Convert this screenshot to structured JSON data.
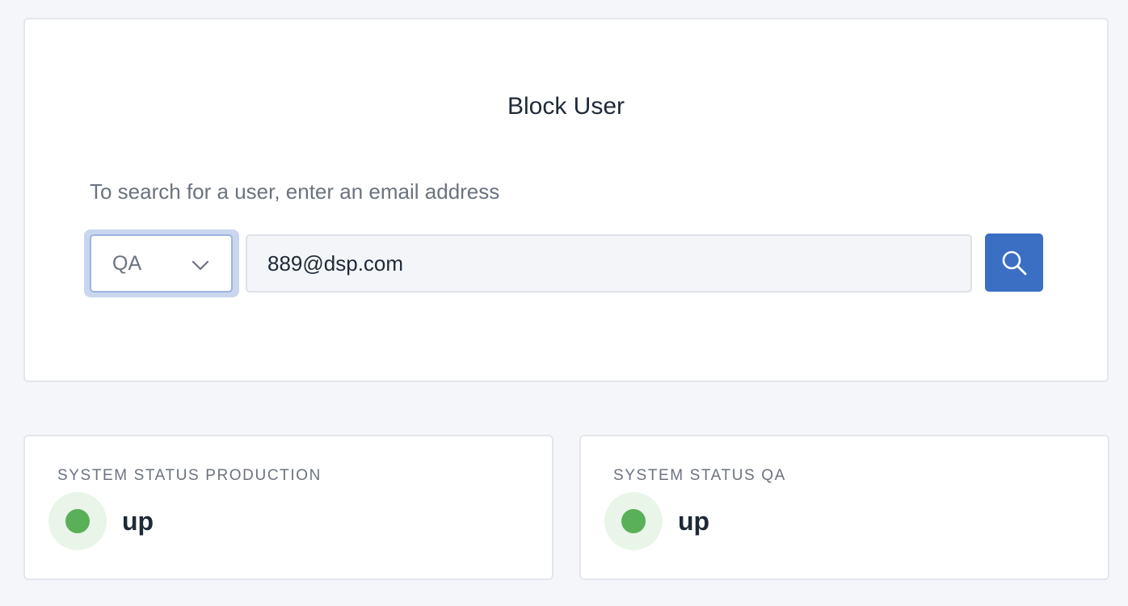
{
  "block_user": {
    "title": "Block User",
    "instruction": "To search for a user, enter an email address",
    "environment_select": {
      "selected": "QA"
    },
    "email_input": {
      "value": "889@dsp.com"
    },
    "search_button": {
      "icon": "search-icon"
    }
  },
  "status": [
    {
      "label": "SYSTEM STATUS PRODUCTION",
      "value": "up",
      "color": "#5aaf59"
    },
    {
      "label": "SYSTEM STATUS QA",
      "value": "up",
      "color": "#5aaf59"
    }
  ],
  "colors": {
    "accent": "#3a6fc4",
    "status_up": "#5aaf59"
  }
}
